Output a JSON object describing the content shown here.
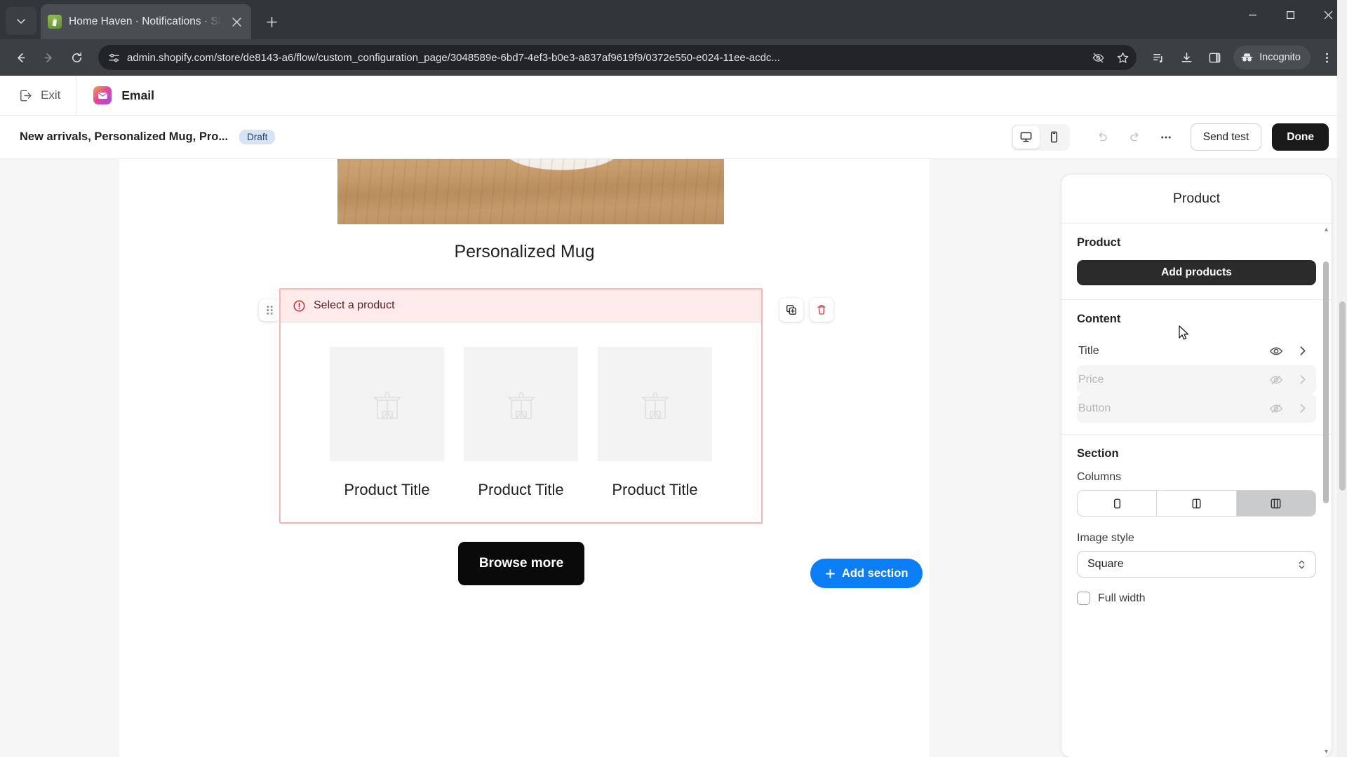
{
  "browser": {
    "tab": {
      "title": "Home Haven · Notifications · Sh",
      "favicon": "shopify-bag-icon",
      "close": "close-icon"
    },
    "new_tab": "+",
    "nav": {
      "back": "back-arrow-icon",
      "forward": "forward-arrow-icon",
      "reload": "reload-icon"
    },
    "omnibox": {
      "site_info_icon": "site-settings-icon",
      "url": "admin.shopify.com/store/de8143-a6/flow/custom_configuration_page/3048589e-6bd7-4ef3-b0e3-a837af9619f9/0372e550-e024-11ee-acdc...",
      "hide_icon": "eye-off-icon",
      "bookmark_icon": "star-icon"
    },
    "actions": {
      "split_icon": "reading-list-icon",
      "download_icon": "download-icon",
      "sidepanel_icon": "side-panel-icon",
      "incognito_label": "Incognito",
      "incognito_icon": "incognito-icon",
      "menu_icon": "kebab-menu-icon"
    },
    "window": {
      "minimize": "minimize-icon",
      "maximize": "maximize-icon",
      "close": "window-close-icon"
    }
  },
  "topbar": {
    "exit_label": "Exit",
    "exit_icon": "exit-icon",
    "channel_icon": "email-app-icon",
    "channel_label": "Email"
  },
  "subbar": {
    "doc_title": "New arrivals, Personalized Mug, Pro...",
    "status_badge": "Draft",
    "desktop_icon": "desktop-icon",
    "mobile_icon": "mobile-icon",
    "undo_icon": "undo-icon",
    "redo_icon": "redo-icon",
    "more_icon": "ellipsis-icon",
    "send_test_label": "Send test",
    "done_label": "Done"
  },
  "canvas": {
    "hero_caption": "Personalized Mug",
    "drag_handle_icon": "drag-dots-icon",
    "duplicate_icon": "duplicate-icon",
    "delete_icon": "trash-icon",
    "error": {
      "icon": "alert-circle-icon",
      "text": "Select a product"
    },
    "products": [
      {
        "placeholder_icon": "product-placeholder-icon",
        "title": "Product Title"
      },
      {
        "placeholder_icon": "product-placeholder-icon",
        "title": "Product Title"
      },
      {
        "placeholder_icon": "product-placeholder-icon",
        "title": "Product Title"
      }
    ],
    "browse_more_label": "Browse more",
    "add_section_label": "Add section",
    "add_section_icon": "plus-icon"
  },
  "panel": {
    "header": "Product",
    "product_group": {
      "title": "Product",
      "add_button": "Add products"
    },
    "content_group": {
      "title": "Content",
      "rows": [
        {
          "label": "Title",
          "visibility_icon": "eye-icon",
          "chevron_icon": "chevron-right-icon",
          "enabled": true
        },
        {
          "label": "Price",
          "visibility_icon": "eye-off-icon",
          "chevron_icon": "chevron-right-icon",
          "enabled": false
        },
        {
          "label": "Button",
          "visibility_icon": "eye-off-icon",
          "chevron_icon": "chevron-right-icon",
          "enabled": false
        }
      ]
    },
    "section_group": {
      "title": "Section",
      "columns_label": "Columns",
      "columns_options": [
        "one-column-icon",
        "two-column-icon",
        "three-column-icon"
      ],
      "columns_selected": 2,
      "image_style_label": "Image style",
      "image_style_value": "Square",
      "full_width_label": "Full width"
    }
  },
  "colors": {
    "accent_blue": "#0b7ef5",
    "error_bg": "#fdeaea",
    "error_border": "#f6b6b6",
    "primary_dark": "#1a1a1a",
    "draft_badge_bg": "#d6e4f5"
  }
}
